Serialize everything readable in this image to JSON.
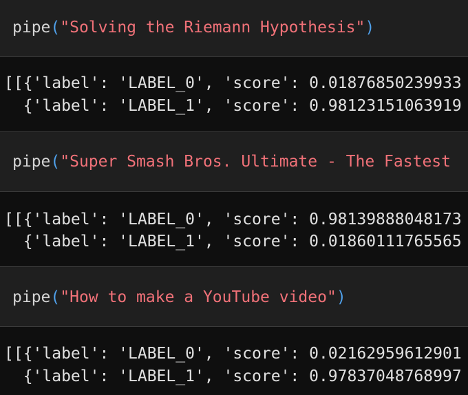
{
  "cells": [
    {
      "input": {
        "fn": "pipe",
        "open": "(",
        "arg": "\"Solving the Riemann Hypothesis\"",
        "close": ")"
      },
      "output": {
        "line1": "[[{'label': 'LABEL_0', 'score': 0.01876850239933",
        "line2": "  {'label': 'LABEL_1', 'score': 0.98123151063919"
      }
    },
    {
      "input": {
        "fn": "pipe",
        "open": "(",
        "arg": "\"Super Smash Bros. Ultimate - The Fastest",
        "close": ""
      },
      "output": {
        "line1": "[[{'label': 'LABEL_0', 'score': 0.98139888048173",
        "line2": "  {'label': 'LABEL_1', 'score': 0.01860111765565"
      }
    },
    {
      "input": {
        "fn": "pipe",
        "open": "(",
        "arg": "\"How to make a YouTube video\"",
        "close": ")"
      },
      "output": {
        "line1": "[[{'label': 'LABEL_0', 'score': 0.02162959612901",
        "line2": "  {'label': 'LABEL_1', 'score': 0.97837048768997"
      }
    }
  ],
  "colors": {
    "input_background": "#1f1f1f",
    "output_background": "#0f0f0f",
    "string": "#f07178",
    "paren": "#4f9fe8",
    "text": "#e0e0e0"
  }
}
